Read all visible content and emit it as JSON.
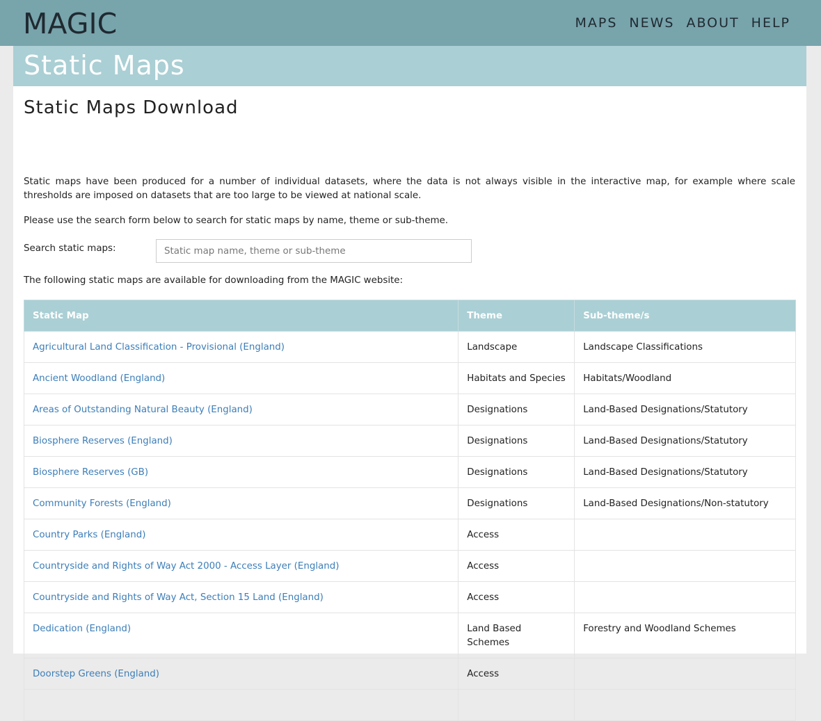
{
  "header": {
    "logo_text": "MAGIC",
    "nav": [
      {
        "label": "MAPS"
      },
      {
        "label": "NEWS"
      },
      {
        "label": "ABOUT"
      },
      {
        "label": "HELP"
      }
    ]
  },
  "banner": {
    "title": "Static Maps"
  },
  "main": {
    "heading": "Static Maps Download",
    "intro": "Static maps have been produced for a number of individual datasets, where the data is not always visible in the interactive map, for example where scale thresholds are imposed on datasets that are too large to be viewed at national scale.",
    "instructions": "Please use the search form below to search for static maps by name, theme or sub-theme.",
    "search": {
      "label": "Search static maps:",
      "placeholder": "Static map name, theme or sub-theme",
      "value": ""
    },
    "following": "The following static maps are available for downloading from the MAGIC website:",
    "table": {
      "headers": [
        "Static Map",
        "Theme",
        "Sub-theme/s"
      ],
      "rows": [
        {
          "map": "Agricultural Land Classification - Provisional (England)",
          "theme": "Landscape",
          "subtheme": "Landscape Classifications"
        },
        {
          "map": "Ancient Woodland (England)",
          "theme": "Habitats and Species",
          "subtheme": "Habitats/Woodland"
        },
        {
          "map": "Areas of Outstanding Natural Beauty (England)",
          "theme": "Designations",
          "subtheme": "Land-Based Designations/Statutory"
        },
        {
          "map": "Biosphere Reserves (England)",
          "theme": "Designations",
          "subtheme": "Land-Based Designations/Statutory"
        },
        {
          "map": "Biosphere Reserves (GB)",
          "theme": "Designations",
          "subtheme": "Land-Based Designations/Statutory"
        },
        {
          "map": "Community Forests (England)",
          "theme": "Designations",
          "subtheme": "Land-Based Designations/Non-statutory"
        },
        {
          "map": "Country Parks (England)",
          "theme": "Access",
          "subtheme": ""
        },
        {
          "map": "Countryside and Rights of Way Act 2000 - Access Layer (England)",
          "theme": "Access",
          "subtheme": ""
        },
        {
          "map": "Countryside and Rights of Way Act, Section 15 Land (England)",
          "theme": "Access",
          "subtheme": ""
        },
        {
          "map": "Dedication (England)",
          "theme": "Land Based Schemes",
          "subtheme": "Forestry and Woodland Schemes"
        },
        {
          "map": "Doorstep Greens (England)",
          "theme": "Access",
          "subtheme": ""
        }
      ]
    }
  },
  "colors": {
    "header_bg": "#78a4ac",
    "banner_bg": "#aacfd4",
    "link": "#3c7eb8",
    "page_bg": "#ebebeb"
  }
}
